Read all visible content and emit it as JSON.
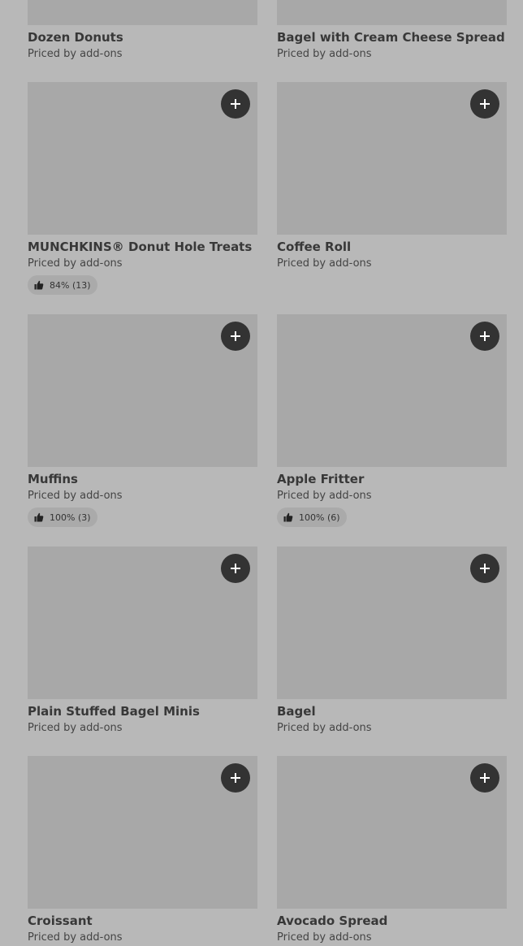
{
  "items": [
    {
      "name": "Dozen Donuts",
      "price": "Priced by add-ons"
    },
    {
      "name": "Bagel with Cream Cheese Spread",
      "price": "Priced by add-ons"
    },
    {
      "name": "MUNCHKINS® Donut Hole Treats",
      "price": "Priced by add-ons",
      "rating": "84% (13)"
    },
    {
      "name": "Coffee Roll",
      "price": "Priced by add-ons"
    },
    {
      "name": "Muffins",
      "price": "Priced by add-ons",
      "rating": "100% (3)"
    },
    {
      "name": "Apple Fritter",
      "price": "Priced by add-ons",
      "rating": "100% (6)"
    },
    {
      "name": "Plain Stuffed Bagel Minis",
      "price": "Priced by add-ons"
    },
    {
      "name": "Bagel",
      "price": "Priced by add-ons"
    },
    {
      "name": "Croissant",
      "price": "Priced by add-ons"
    },
    {
      "name": "Avocado Spread",
      "price": "Priced by add-ons"
    }
  ],
  "icons": {
    "add": "plus-icon",
    "rating": "thumbs-up-icon"
  },
  "colors": {
    "background": "#b8b8b8",
    "image_placeholder": "#a8a8a8",
    "add_button": "#333333",
    "rating_pill": "#aaaaaa"
  }
}
